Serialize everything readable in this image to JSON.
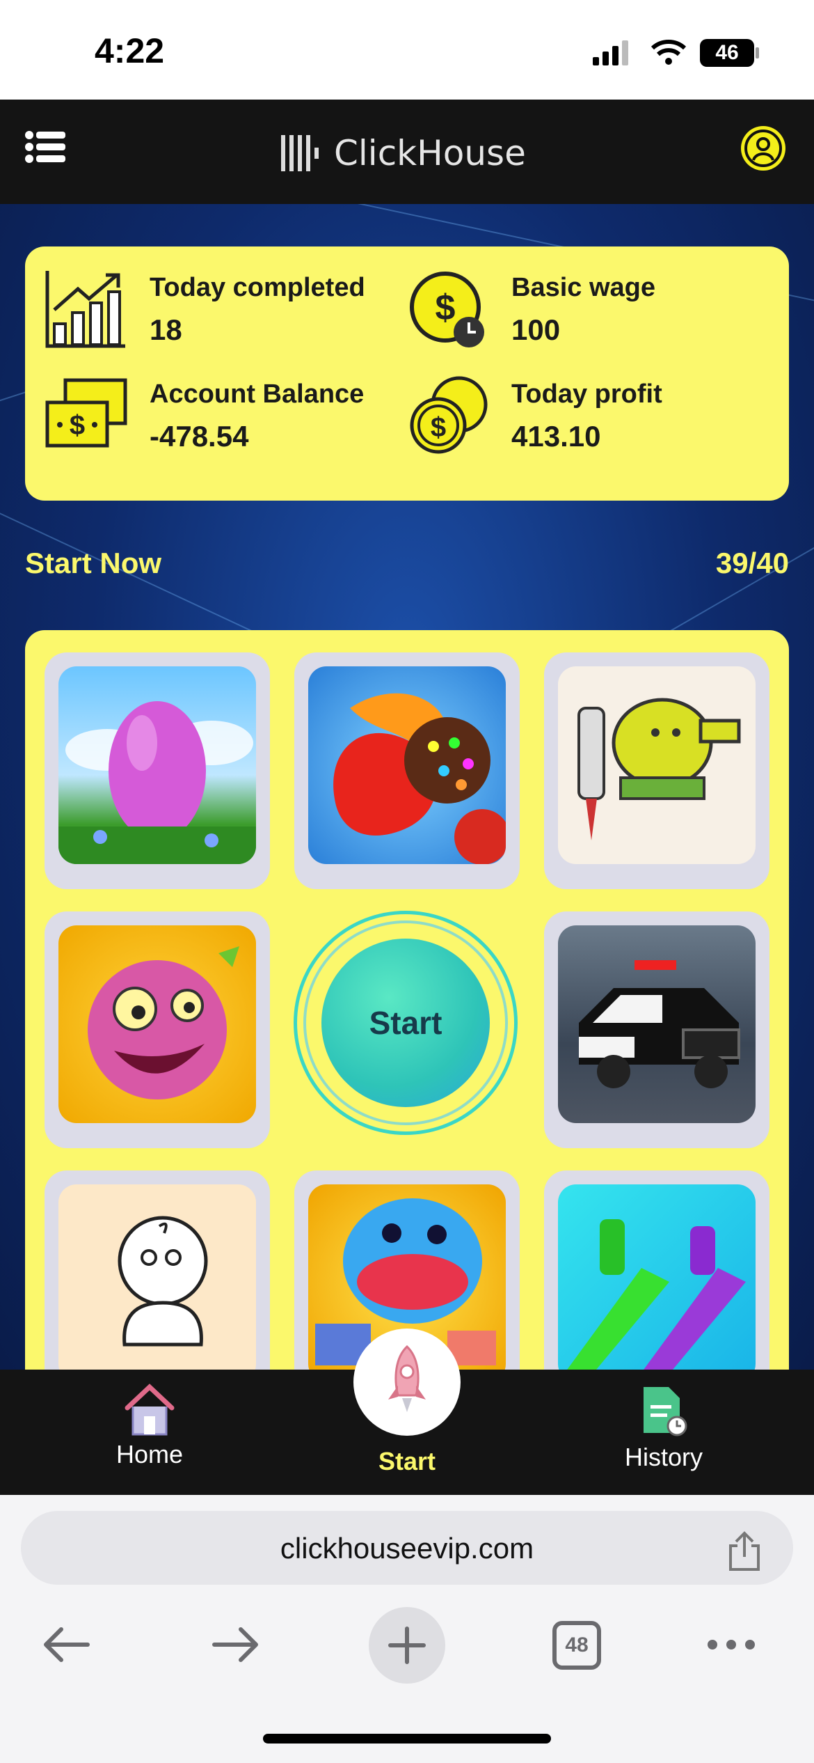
{
  "status_bar": {
    "time": "4:22",
    "battery": "46"
  },
  "header": {
    "brand": "ClickHouse"
  },
  "stats": [
    {
      "label": "Today completed",
      "value": "18"
    },
    {
      "label": "Basic wage",
      "value": "100"
    },
    {
      "label": "Account Balance",
      "value": "-478.54"
    },
    {
      "label": "Today profit",
      "value": "413.10"
    }
  ],
  "section": {
    "title": "Start Now",
    "progress": "39/40"
  },
  "start_button": {
    "label": "Start"
  },
  "nav": {
    "home": "Home",
    "start": "Start",
    "history": "History"
  },
  "browser": {
    "url": "clickhouseevip.com",
    "tab_count": "48"
  },
  "colors": {
    "accent": "#fbf86c",
    "dark": "#141414",
    "start_teal": "#3ad6c6"
  }
}
